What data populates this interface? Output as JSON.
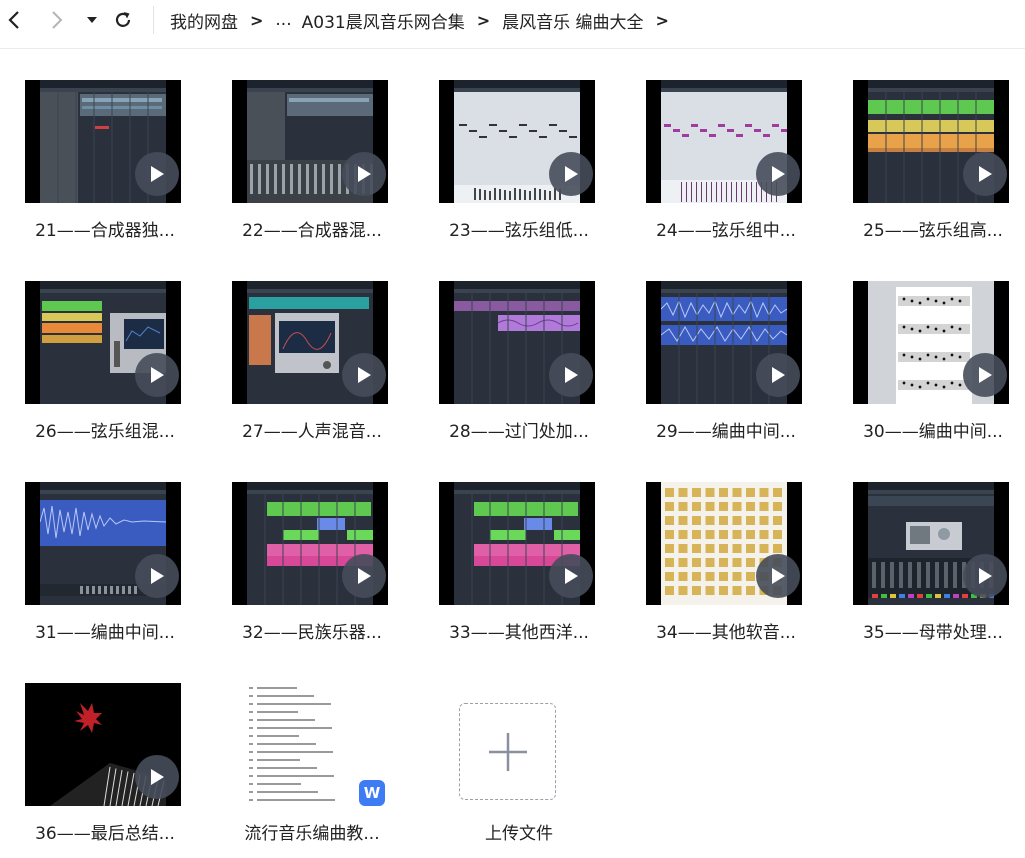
{
  "toolbar": {
    "back_icon": "chevron-left-icon",
    "forward_icon": "chevron-right-icon",
    "history_icon": "caret-down-icon",
    "refresh_icon": "refresh-icon"
  },
  "breadcrumb": {
    "items": [
      "我的网盘",
      "...",
      "A031晨风音乐网合集",
      "晨风音乐 编曲大全"
    ],
    "separator": ">"
  },
  "files": [
    {
      "name": "21——合成器独...",
      "type": "video",
      "theme": "fl-dark"
    },
    {
      "name": "22——合成器混...",
      "type": "video",
      "theme": "fl-mixer"
    },
    {
      "name": "23——弦乐组低...",
      "type": "video",
      "theme": "piano-roll-light"
    },
    {
      "name": "24——弦乐组中...",
      "type": "video",
      "theme": "piano-roll-purple"
    },
    {
      "name": "25——弦乐组高...",
      "type": "video",
      "theme": "tracks-color"
    },
    {
      "name": "26——弦乐组混...",
      "type": "video",
      "theme": "tracks-plugin"
    },
    {
      "name": "27——人声混音...",
      "type": "video",
      "theme": "vocal-plugin"
    },
    {
      "name": "28——过门处加...",
      "type": "video",
      "theme": "tracks-purple"
    },
    {
      "name": "29——编曲中间...",
      "type": "video",
      "theme": "waveform-blue"
    },
    {
      "name": "30——编曲中间...",
      "type": "video",
      "theme": "score-sheet"
    },
    {
      "name": "31——编曲中间...",
      "type": "video",
      "theme": "waveform-long"
    },
    {
      "name": "32——民族乐器...",
      "type": "video",
      "theme": "tracks-green-pink"
    },
    {
      "name": "33——其他西洋...",
      "type": "video",
      "theme": "tracks-green-pink"
    },
    {
      "name": "34——其他软音...",
      "type": "video",
      "theme": "folders-grid"
    },
    {
      "name": "35——母带处理...",
      "type": "video",
      "theme": "mastering"
    },
    {
      "name": "36——最后总结...",
      "type": "video",
      "theme": "piano-logo"
    },
    {
      "name": "流行音乐编曲教...",
      "type": "document",
      "badge": "W"
    },
    {
      "name": "上传文件",
      "type": "upload"
    }
  ],
  "colors": {
    "play_bg": "#464c5a",
    "wps_blue": "#3d7cf4",
    "daw_bg": "#2a313c"
  }
}
